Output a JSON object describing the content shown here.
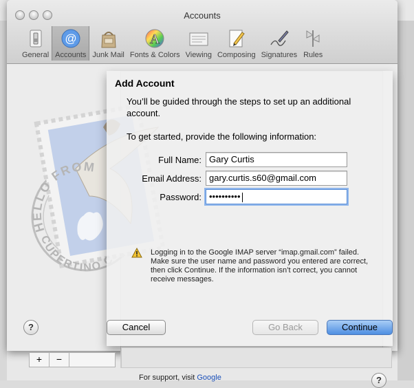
{
  "window": {
    "title": "Accounts"
  },
  "toolbar": {
    "items": [
      {
        "label": "General",
        "icon": "general-switch-icon"
      },
      {
        "label": "Accounts",
        "icon": "at-sign-icon",
        "selected": true
      },
      {
        "label": "Junk Mail",
        "icon": "junk-mail-bag-icon"
      },
      {
        "label": "Fonts & Colors",
        "icon": "fonts-colors-icon"
      },
      {
        "label": "Viewing",
        "icon": "viewing-icon"
      },
      {
        "label": "Composing",
        "icon": "composing-pencil-icon"
      },
      {
        "label": "Signatures",
        "icon": "signature-pen-icon"
      },
      {
        "label": "Rules",
        "icon": "rules-icon"
      }
    ]
  },
  "sheet": {
    "heading": "Add Account",
    "intro": "You’ll be guided through the steps to set up an additional account.",
    "prompt": "To get started, provide the following information:",
    "fields": {
      "full_name": {
        "label": "Full Name:",
        "value": "Gary Curtis"
      },
      "email": {
        "label": "Email Address:",
        "value": "gary.curtis.s60@gmail.com"
      },
      "password": {
        "label": "Password:",
        "value": "••••••••••"
      }
    },
    "warning": "Logging in to the Google IMAP server “imap.gmail.com” failed. Make sure the user name and password you entered are correct, then click Continue. If the information isn’t correct, you cannot receive messages.",
    "buttons": {
      "help": "?",
      "cancel": "Cancel",
      "go_back": "Go Back",
      "continue": "Continue"
    },
    "stamp_text": "HELLO FROM CUPERTINO CA"
  },
  "footer": {
    "add": "+",
    "remove": "−",
    "support_prefix": "For support, visit",
    "support_link": "Google",
    "help": "?"
  }
}
